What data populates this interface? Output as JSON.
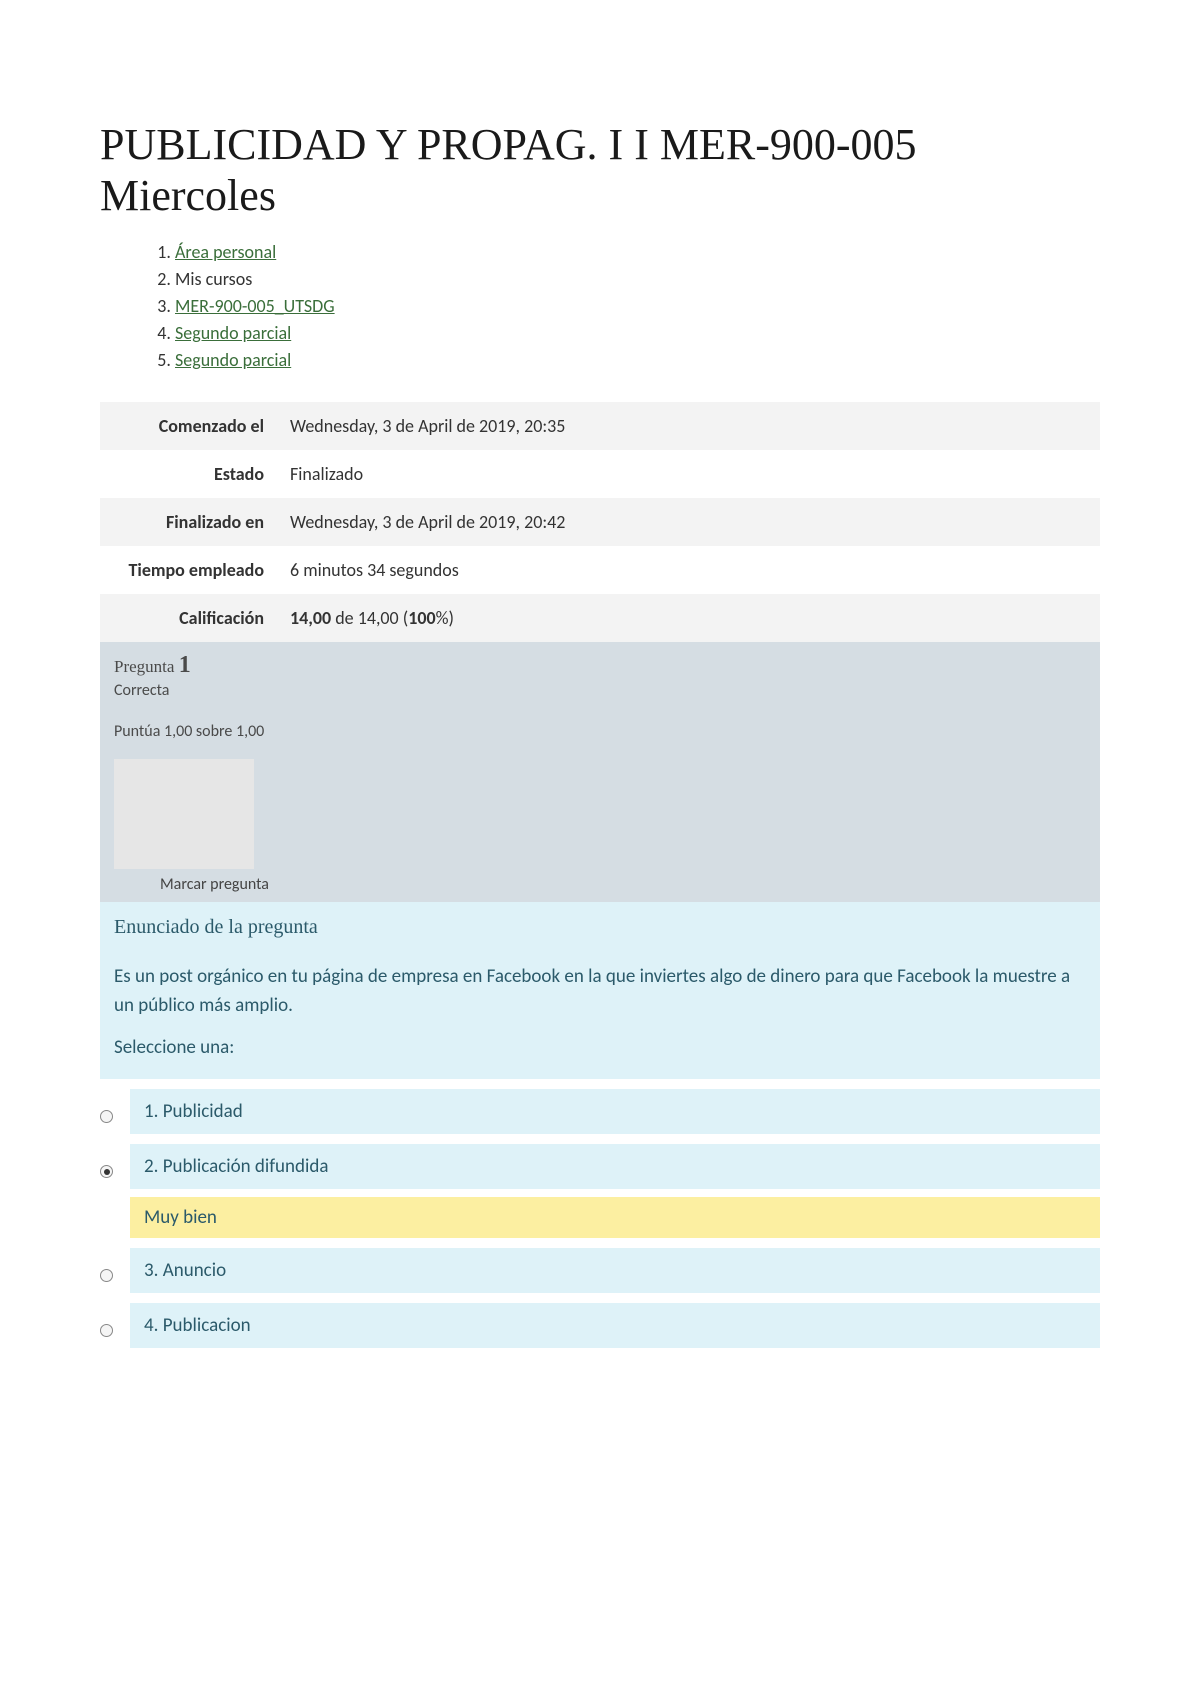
{
  "title": "PUBLICIDAD Y PROPAG. I I MER-900-005 Miercoles",
  "breadcrumbs": [
    {
      "label": "Área personal",
      "link": true
    },
    {
      "label": "Mis cursos",
      "link": false
    },
    {
      "label": "MER-900-005_UTSDG",
      "link": true
    },
    {
      "label": "Segundo parcial",
      "link": true
    },
    {
      "label": "Segundo parcial",
      "link": true
    }
  ],
  "summary": {
    "startedLabel": "Comenzado el",
    "startedValue": "Wednesday, 3 de April de 2019, 20:35",
    "stateLabel": "Estado",
    "stateValue": "Finalizado",
    "finishedLabel": "Finalizado en",
    "finishedValue": "Wednesday, 3 de April de 2019, 20:42",
    "timeLabel": "Tiempo empleado",
    "timeValue": "6 minutos 34 segundos",
    "gradeLabel": "Calificación",
    "gradeScore": "14,00",
    "gradeOf": " de 14,00 (",
    "gradePct": "100",
    "gradeClose": "%)"
  },
  "question": {
    "label": "Pregunta ",
    "number": "1",
    "status": "Correcta",
    "score": "Puntúa 1,00 sobre 1,00",
    "flagLabel": "Marcar pregunta",
    "contentHeader": "Enunciado de la pregunta",
    "text": "Es un post orgánico en tu página de empresa en Facebook en la que inviertes algo de dinero para que Facebook la muestre a un público más amplio.",
    "selectOne": "Seleccione una:",
    "answers": [
      {
        "num": "1.",
        "text": "Publicidad",
        "checked": false
      },
      {
        "num": "2.",
        "text": "Publicación difundida",
        "checked": true
      },
      {
        "num": "3.",
        "text": "Anuncio",
        "checked": false
      },
      {
        "num": "4.",
        "text": "Publicacion",
        "checked": false
      }
    ],
    "feedback": "Muy bien"
  }
}
